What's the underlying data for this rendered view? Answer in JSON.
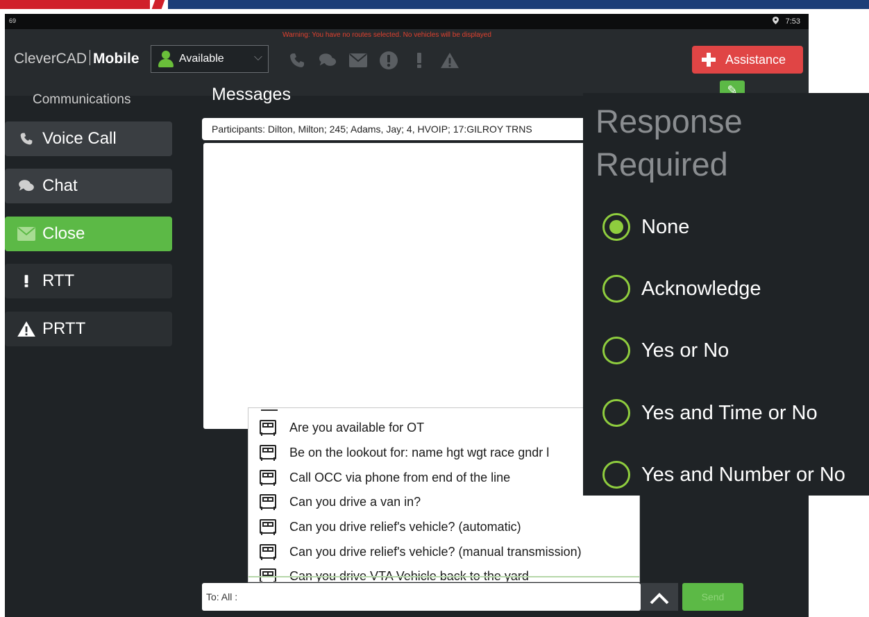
{
  "statusbar": {
    "left_text": "69",
    "time": "7:53"
  },
  "header": {
    "warning": "Warning: You have no routes selected. No vehicles will be displayed",
    "brand_light": "CleverCAD",
    "brand_bold": "Mobile",
    "status_value": "Available",
    "icons": [
      "phone-icon",
      "chat-icon",
      "envelope-icon",
      "alert-circle-icon",
      "exclamation-icon",
      "warning-triangle-icon"
    ],
    "assistance_label": "Assistance"
  },
  "sidebar": {
    "title": "Communications",
    "items": [
      {
        "label": "Voice Call",
        "icon": "phone-icon",
        "state": "normal"
      },
      {
        "label": "Chat",
        "icon": "chat-icon",
        "state": "normal"
      },
      {
        "label": "Close",
        "icon": "envelope-icon",
        "state": "active"
      },
      {
        "label": "RTT",
        "icon": "exclamation-icon",
        "state": "dark"
      },
      {
        "label": "PRTT",
        "icon": "warning-triangle-icon",
        "state": "dark"
      }
    ]
  },
  "messages": {
    "title": "Messages",
    "participants": "Participants: Dilton, Milton; 245; Adams, Jay; 4, HVOIP; 17:GILROY TRNS",
    "to_placeholder": "To: All :",
    "send_label": "Send"
  },
  "canned_messages": [
    "Are you available for OT",
    "Be on the lookout for: name hgt wgt race gndr l",
    "Call OCC via phone from end of the line",
    "Can you drive a van in?",
    "Can you drive relief's vehicle? (automatic)",
    "Can you drive relief's vehicle? (manual transmission)",
    "Can you drive VTA Vehicle back to the yard"
  ],
  "response_popup": {
    "title_line1": "Response",
    "title_line2": "Required",
    "selected": "None",
    "options": [
      "None",
      "Acknowledge",
      "Yes or No",
      "Yes and Time or No",
      "Yes and Number or No"
    ]
  },
  "colors": {
    "accent_green": "#5cb946",
    "assistance_red": "#e04545",
    "warning_red": "#e0412f",
    "radio_green": "#8fcd3e"
  }
}
